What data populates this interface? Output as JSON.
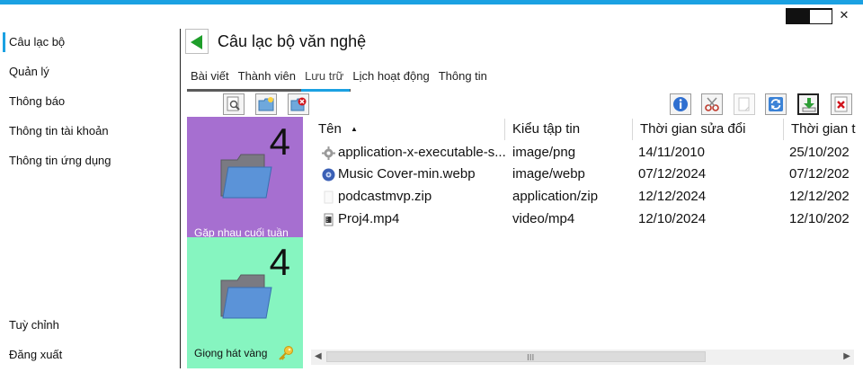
{
  "window": {
    "close_glyph": "✕"
  },
  "sidebar": {
    "items": [
      {
        "label": "Câu lạc bộ"
      },
      {
        "label": "Quản lý"
      },
      {
        "label": "Thông báo"
      },
      {
        "label": "Thông tin tài khoản"
      },
      {
        "label": "Thông tin ứng dụng"
      }
    ],
    "bottom": [
      {
        "label": "Tuỳ chỉnh"
      },
      {
        "label": "Đăng xuất"
      }
    ]
  },
  "header": {
    "title": "Câu lạc bộ văn nghệ"
  },
  "tabs": [
    {
      "label": "Bài viết"
    },
    {
      "label": "Thành viên"
    },
    {
      "label": "Lưu trữ"
    },
    {
      "label": "Lịch hoạt động"
    },
    {
      "label": "Thông tin"
    }
  ],
  "folders": [
    {
      "name": "Gặp nhau cuối tuần",
      "count": "4",
      "color": "#a66fd0"
    },
    {
      "name": "Giọng hát vàng",
      "count": "4",
      "color": "#86f5c0"
    }
  ],
  "files": {
    "columns": [
      "Tên",
      "Kiểu tập tin",
      "Thời gian sửa đổi",
      "Thời gian t"
    ],
    "sort_indicator": "▲",
    "rows": [
      {
        "icon": "gear-file-icon",
        "name": "application-x-executable-s...",
        "type": "image/png",
        "modified": "14/11/2010",
        "created": "25/10/202"
      },
      {
        "icon": "media-file-icon",
        "name": "Music Cover-min.webp",
        "type": "image/webp",
        "modified": "07/12/2024",
        "created": "07/12/202"
      },
      {
        "icon": "blank-file-icon",
        "name": "podcastmvp.zip",
        "type": "application/zip",
        "modified": "12/12/2024",
        "created": "12/12/202"
      },
      {
        "icon": "video-file-icon",
        "name": "Proj4.mp4",
        "type": "video/mp4",
        "modified": "12/10/2024",
        "created": "12/10/202"
      }
    ]
  },
  "scrollbar": {
    "left_arrow": "◀",
    "right_arrow": "▶",
    "grip": "III"
  }
}
